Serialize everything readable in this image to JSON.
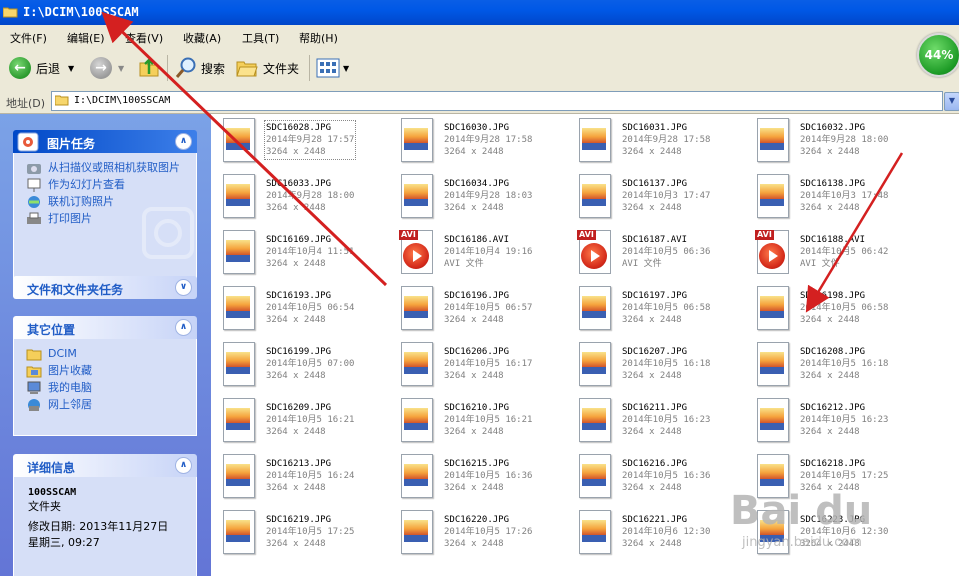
{
  "window": {
    "title": "I:\\DCIM\\100SSCAM"
  },
  "menu": [
    "文件(F)",
    "编辑(E)",
    "查看(V)",
    "收藏(A)",
    "工具(T)",
    "帮助(H)"
  ],
  "toolbar": {
    "back_label": "后退",
    "search_label": "搜索",
    "folders_label": "文件夹"
  },
  "progress_badge": "44%",
  "address": {
    "label": "地址(D)",
    "value": "I:\\DCIM\\100SSCAM"
  },
  "left_panels": {
    "picture_tasks": {
      "title": "图片任务",
      "links": [
        "从扫描仪或照相机获取图片",
        "作为幻灯片查看",
        "联机订购照片",
        "打印图片"
      ]
    },
    "file_tasks": {
      "title": "文件和文件夹任务"
    },
    "other_places": {
      "title": "其它位置",
      "links": [
        "DCIM",
        "图片收藏",
        "我的电脑",
        "网上邻居"
      ]
    },
    "details": {
      "title": "详细信息",
      "name": "100SSCAM",
      "kind": "文件夹",
      "modified": "修改日期: 2013年11月27日",
      "weekday": "星期三, 09:27"
    }
  },
  "files": [
    {
      "name": "SDC16028.JPG",
      "line2": "2014年9月28 17:57",
      "line3": "3264 x 2448",
      "type": "jpg",
      "selected": true
    },
    {
      "name": "SDC16030.JPG",
      "line2": "2014年9月28 17:58",
      "line3": "3264 x 2448",
      "type": "jpg"
    },
    {
      "name": "SDC16031.JPG",
      "line2": "2014年9月28 17:58",
      "line3": "3264 x 2448",
      "type": "jpg"
    },
    {
      "name": "SDC16032.JPG",
      "line2": "2014年9月28 18:00",
      "line3": "3264 x 2448",
      "type": "jpg"
    },
    {
      "name": "SDC16033.JPG",
      "line2": "2014年9月28 18:00",
      "line3": "3264 x 2448",
      "type": "jpg"
    },
    {
      "name": "SDC16034.JPG",
      "line2": "2014年9月28 18:03",
      "line3": "3264 x 2448",
      "type": "jpg"
    },
    {
      "name": "SDC16137.JPG",
      "line2": "2014年10月3 17:47",
      "line3": "3264 x 2448",
      "type": "jpg"
    },
    {
      "name": "SDC16138.JPG",
      "line2": "2014年10月3 17:48",
      "line3": "3264 x 2448",
      "type": "jpg"
    },
    {
      "name": "SDC16169.JPG",
      "line2": "2014年10月4 11:51",
      "line3": "3264 x 2448",
      "type": "jpg"
    },
    {
      "name": "SDC16186.AVI",
      "line2": "2014年10月4 19:16",
      "line3": "AVI 文件",
      "type": "avi"
    },
    {
      "name": "SDC16187.AVI",
      "line2": "2014年10月5 06:36",
      "line3": "AVI 文件",
      "type": "avi"
    },
    {
      "name": "SDC16188.AVI",
      "line2": "2014年10月5 06:42",
      "line3": "AVI 文件",
      "type": "avi"
    },
    {
      "name": "SDC16193.JPG",
      "line2": "2014年10月5 06:54",
      "line3": "3264 x 2448",
      "type": "jpg"
    },
    {
      "name": "SDC16196.JPG",
      "line2": "2014年10月5 06:57",
      "line3": "3264 x 2448",
      "type": "jpg"
    },
    {
      "name": "SDC16197.JPG",
      "line2": "2014年10月5 06:58",
      "line3": "3264 x 2448",
      "type": "jpg"
    },
    {
      "name": "SDC16198.JPG",
      "line2": "2014年10月5 06:58",
      "line3": "3264 x 2448",
      "type": "jpg"
    },
    {
      "name": "SDC16199.JPG",
      "line2": "2014年10月5 07:00",
      "line3": "3264 x 2448",
      "type": "jpg"
    },
    {
      "name": "SDC16206.JPG",
      "line2": "2014年10月5 16:17",
      "line3": "3264 x 2448",
      "type": "jpg"
    },
    {
      "name": "SDC16207.JPG",
      "line2": "2014年10月5 16:18",
      "line3": "3264 x 2448",
      "type": "jpg"
    },
    {
      "name": "SDC16208.JPG",
      "line2": "2014年10月5 16:18",
      "line3": "3264 x 2448",
      "type": "jpg"
    },
    {
      "name": "SDC16209.JPG",
      "line2": "2014年10月5 16:21",
      "line3": "3264 x 2448",
      "type": "jpg"
    },
    {
      "name": "SDC16210.JPG",
      "line2": "2014年10月5 16:21",
      "line3": "3264 x 2448",
      "type": "jpg"
    },
    {
      "name": "SDC16211.JPG",
      "line2": "2014年10月5 16:23",
      "line3": "3264 x 2448",
      "type": "jpg"
    },
    {
      "name": "SDC16212.JPG",
      "line2": "2014年10月5 16:23",
      "line3": "3264 x 2448",
      "type": "jpg"
    },
    {
      "name": "SDC16213.JPG",
      "line2": "2014年10月5 16:24",
      "line3": "3264 x 2448",
      "type": "jpg"
    },
    {
      "name": "SDC16215.JPG",
      "line2": "2014年10月5 16:36",
      "line3": "3264 x 2448",
      "type": "jpg"
    },
    {
      "name": "SDC16216.JPG",
      "line2": "2014年10月5 16:36",
      "line3": "3264 x 2448",
      "type": "jpg"
    },
    {
      "name": "SDC16218.JPG",
      "line2": "2014年10月5 17:25",
      "line3": "3264 x 2448",
      "type": "jpg"
    },
    {
      "name": "SDC16219.JPG",
      "line2": "2014年10月5 17:25",
      "line3": "3264 x 2448",
      "type": "jpg"
    },
    {
      "name": "SDC16220.JPG",
      "line2": "2014年10月5 17:26",
      "line3": "3264 x 2448",
      "type": "jpg"
    },
    {
      "name": "SDC16221.JPG",
      "line2": "2014年10月6 12:30",
      "line3": "3264 x 2448",
      "type": "jpg"
    },
    {
      "name": "SDC16223.JPG",
      "line2": "2014年10月6 12:30",
      "line3": "3264 x 2448",
      "type": "jpg"
    }
  ],
  "watermark": {
    "text": "Bai du",
    "sub": "jingyan.baidu.com"
  },
  "colors": {
    "annotation_arrow": "#d42020",
    "titlebar": "#0058e6",
    "sidebar": "#6f8ddf"
  }
}
